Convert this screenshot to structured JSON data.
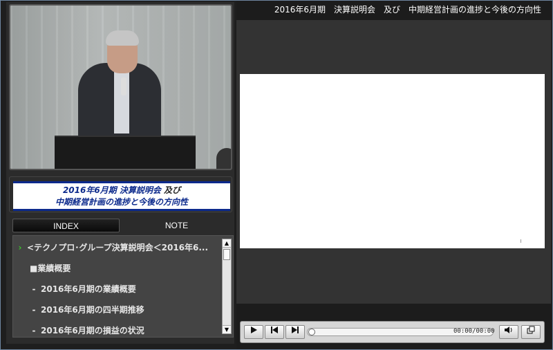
{
  "slide_title": "2016年6月期　決算説明会　及び　中期経営計画の進捗と今後の方向性",
  "title_card": {
    "line1_blue": "2016年6月期 決算説明会",
    "line1_dark": " 及び",
    "line2": "中期経営計画の進捗と今後の方向性"
  },
  "tabs": {
    "index": "INDEX",
    "note": "NOTE"
  },
  "index_items": [
    {
      "mark": "›",
      "label": "<テクノプロ･グループ決算説明会＜2016年6..."
    },
    {
      "mark": "",
      "label": "■業績概要"
    },
    {
      "mark": "-",
      "label": "2016年6月期の業績概要"
    },
    {
      "mark": "-",
      "label": "2016年6月期の四半期推移"
    },
    {
      "mark": "-",
      "label": "2016年6月期の損益の状況"
    }
  ],
  "player": {
    "play_icon": "play-icon",
    "prev_icon": "skip-back-icon",
    "next_icon": "skip-forward-icon",
    "time": "00:00/00:00",
    "progress": 0,
    "volume_icon": "speaker-icon",
    "window_icon": "popout-window-icon"
  }
}
